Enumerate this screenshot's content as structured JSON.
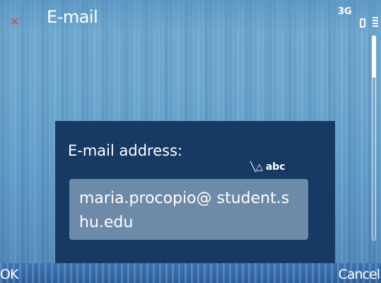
{
  "window": {
    "title": "E-mail"
  },
  "status": {
    "close_icon": "close-icon",
    "network_icon": "network-icon",
    "network_text": "3G",
    "battery_icon": "battery-icon",
    "signal_icon": "signal-icon"
  },
  "dialog": {
    "label": "E-mail address:",
    "input_mode": "abc",
    "input_mode_icon": "pen-icon",
    "value": "maria.procopio@ student.shu.edu"
  },
  "softkeys": {
    "left": "OK",
    "right": "Cancel"
  },
  "colors": {
    "dialog_bg": "#163a64",
    "field_bg": "#6d8aa8",
    "close": "#e0453b"
  }
}
